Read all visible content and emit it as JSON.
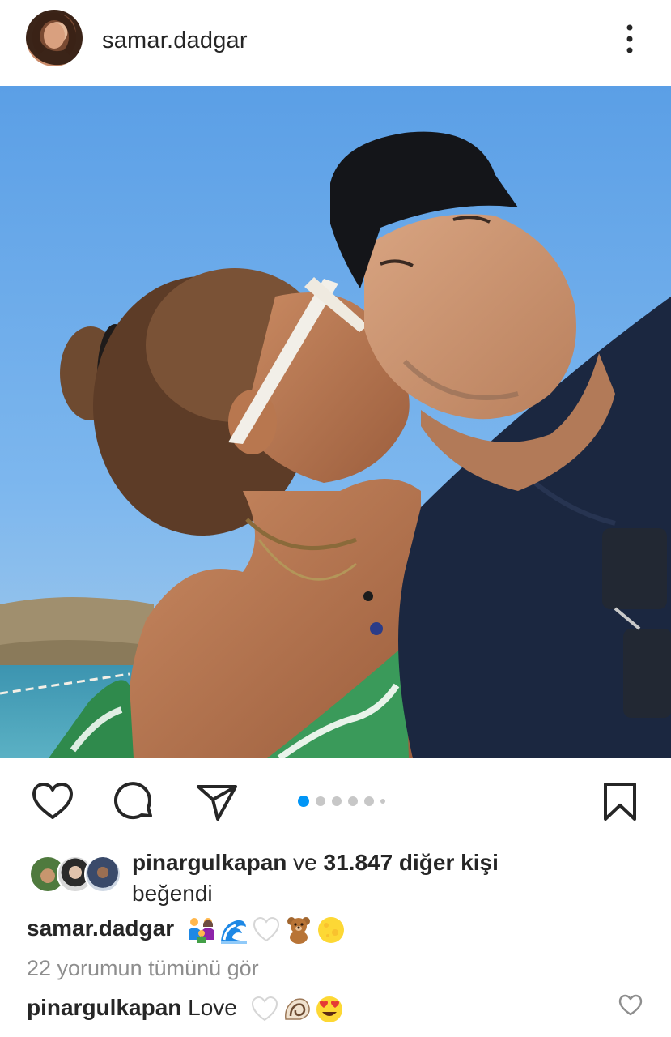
{
  "post": {
    "username": "samar.dadgar",
    "avatar_icon": "profile-avatar",
    "more_icon": "more-vertical-icon"
  },
  "carousel": {
    "total_slides": 6,
    "active_slide": 1
  },
  "actions": {
    "like_icon": "heart-outline-icon",
    "comment_icon": "comment-bubble-icon",
    "share_icon": "paper-plane-icon",
    "save_icon": "bookmark-outline-icon"
  },
  "likes": {
    "liked_by": "pinargulkapan",
    "connector": " ve ",
    "count_text": "31.847 diğer kişi",
    "suffix": "beğendi"
  },
  "caption": {
    "username": "samar.dadgar",
    "emojis": [
      "family",
      "water-wave",
      "white-heart",
      "teddy-bear",
      "full-moon"
    ]
  },
  "comments": {
    "view_all": "22 yorumun tümünü gör",
    "latest": {
      "username": "pinargulkapan",
      "text": "Love",
      "emojis": [
        "white-heart",
        "spiral-shell",
        "heart-eyes"
      ]
    }
  },
  "colors": {
    "text": "#262626",
    "muted": "#8e8e8e",
    "accent": "#0095f6",
    "dot_inactive": "#c7c7c7"
  }
}
